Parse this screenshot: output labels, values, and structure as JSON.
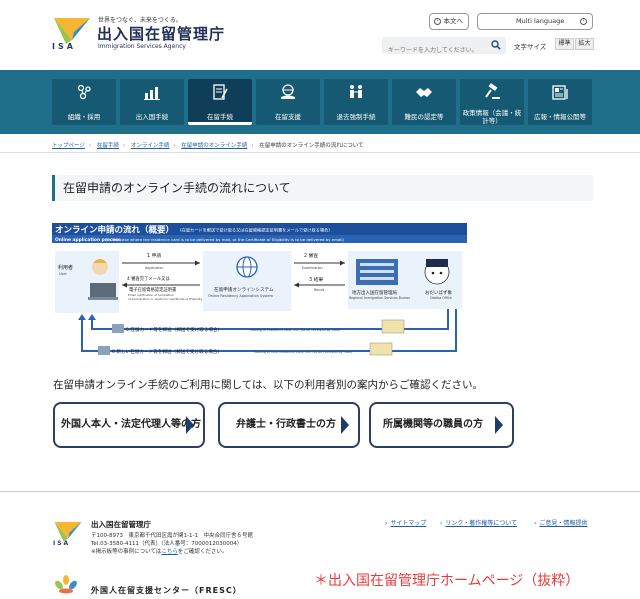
{
  "header": {
    "tagline": "世界をつなぐ、未来をつくる。",
    "org_name": "出入国在留管理庁",
    "org_name_en": "Immigration Services Agency",
    "logo_text": "ISA",
    "kana_button": "本文へ",
    "language_button": "Multi language",
    "search_placeholder": "キーワードを入力してください。",
    "font_size_label": "文字サイズ",
    "font_standard": "標準",
    "font_large": "拡大"
  },
  "nav": {
    "items": [
      {
        "label": "組織・採用",
        "icon": "people-icon"
      },
      {
        "label": "出入国手続",
        "icon": "chart-icon"
      },
      {
        "label": "在留手続",
        "icon": "document-icon",
        "active": true
      },
      {
        "label": "在留支援",
        "icon": "globe-hand-icon"
      },
      {
        "label": "退去強制手続",
        "icon": "persons-icon"
      },
      {
        "label": "難民の認定等",
        "icon": "handshake-icon"
      },
      {
        "label": "政策情報（会議・統計等）",
        "icon": "gavel-icon"
      },
      {
        "label": "広報・情報公開等",
        "icon": "news-icon"
      }
    ]
  },
  "breadcrumb": {
    "items": [
      "トップページ",
      "在留手続",
      "オンライン手続",
      "在留申請のオンライン手続",
      "在留申請のオンライン手続の流れについて"
    ]
  },
  "page_title": "在留申請のオンライン手続の流れについて",
  "diagram": {
    "title": "オンライン申請の流れ（概要）",
    "title_note": "(在留カードを郵送で受け取る又は在留資格認定証明書をメールで受け取る場合)",
    "subtitle_en": "Online application process",
    "subtitle_en_note": "(in the case where the residence card is to be delivered by mail, or the Certificate of Eligibility is to be delivered by email)",
    "user_label": "利用者",
    "user_label_en": "User",
    "system_label": "在留申請オンラインシステム",
    "system_label_en": "Online Residency Application System",
    "bureau_label": "地方出入国在留管理局",
    "bureau_label_en": "Regional Immigration Services Bureau",
    "mascot_label": "おだいばず象",
    "mascot_label_en": "Odaiba Office",
    "step1": "1 申請",
    "step1_en": "Application",
    "step2": "2 審査",
    "step2_en": "Examination",
    "step3": "3 結果",
    "step3_en": "Result",
    "step4": "4 審査完了メール又は",
    "step4b": "電子在留資格認定証明書",
    "step4_en": "Email notification of completion",
    "step4b_en": "of examination or electronic Certificate of Eligibility",
    "step5": "5 在留カード等を郵送（郵送で受け取る場合）",
    "step5_en": "Mailing of residence card, etc. (to be received by mail)",
    "step6": "6 新しい在留カード等を郵送（郵送で受け取る場合）",
    "step6_en": "Mailing of new residence card, etc. (to be received by mail)"
  },
  "intro": "在留申請オンライン手続のご利用に関しては、以下の利用者別の案内からご確認ください。",
  "choices": [
    "外国人本人・法定代理人等の方",
    "弁護士・行政書士の方",
    "所属機関等の職員の方"
  ],
  "footer": {
    "org_name": "出入国在留管理庁",
    "logo_text": "ISA",
    "address": "〒100-8973　東京都千代田区霞が関1-1-1　中央合同庁舎６号館",
    "phone": "Tel.03-3580-4111（代表）（法人番号：7000012030004）",
    "notice_prefix": "※掲示板等の事例については",
    "notice_link": "こちら",
    "notice_suffix": "をご確認ください。",
    "links": [
      "サイトマップ",
      "リンク・著作権等について",
      "ご意見・情報提供"
    ],
    "fresc_label": "外国人在留支援センター（FRESC）"
  },
  "overlay_caption": "＊出入国在留管理庁ホームページ（抜粋）",
  "colors": {
    "nav_bg": "#1f6f8b",
    "nav_item": "#155a72",
    "nav_active": "#0f3f58",
    "accent_blue": "#1e5fa0",
    "diagram_header": "#1e4f9c",
    "caption_red": "#e83c3c"
  }
}
